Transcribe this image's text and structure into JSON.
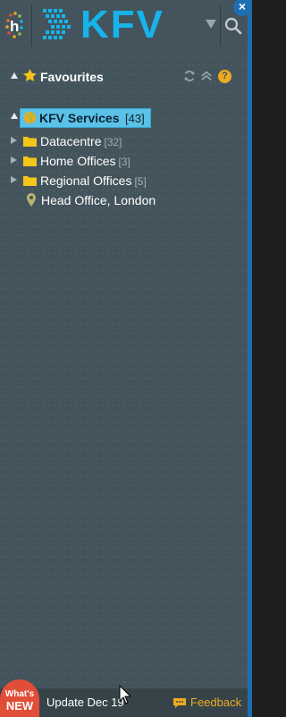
{
  "header": {
    "brand": "KFV",
    "logo_letter": "h"
  },
  "favourites": {
    "label": "Favourites",
    "help_icon_text": "?"
  },
  "tree": {
    "root": {
      "label": "KFV Services",
      "count": "[43]"
    },
    "items": [
      {
        "label": "Datacentre",
        "count": "[32]",
        "type": "folder"
      },
      {
        "label": "Home Offices",
        "count": "[3]",
        "type": "folder"
      },
      {
        "label": "Regional Offices",
        "count": "[5]",
        "type": "folder"
      },
      {
        "label": "Head Office, London",
        "count": "",
        "type": "location"
      }
    ]
  },
  "footer": {
    "whats": "What's",
    "new": "NEW",
    "update": "Update Dec 19",
    "feedback": "Feedback"
  },
  "colors": {
    "accent": "#16b4ea",
    "panel": "#44545c",
    "selection": "#5bc1e7",
    "warning": "#f0a91e",
    "badge": "#e04e39"
  },
  "close_symbol": "×"
}
